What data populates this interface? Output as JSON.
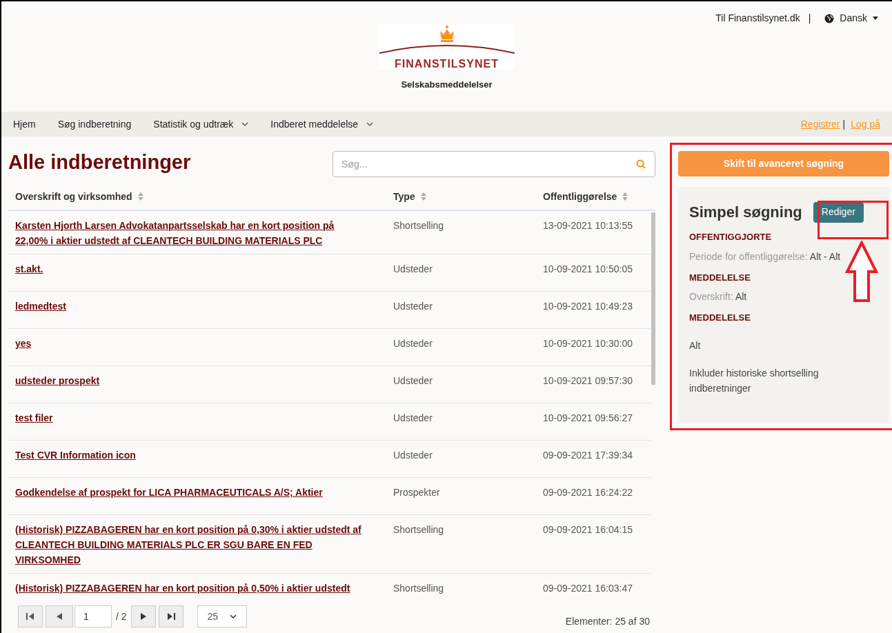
{
  "top_links": {
    "site_link": "Til Finanstilsynet.dk",
    "separator": "|",
    "language": "Dansk"
  },
  "logo": {
    "name": "FINANSTILSYNET",
    "subtitle": "Selskabsmeddelelser"
  },
  "nav": {
    "items": [
      {
        "label": "Hjem",
        "dropdown": false
      },
      {
        "label": "Søg indberetning",
        "dropdown": false
      },
      {
        "label": "Statistik og udtræk",
        "dropdown": true
      },
      {
        "label": "Indberet meddelelse",
        "dropdown": true
      }
    ],
    "auth": {
      "register": "Registrer",
      "separator": "|",
      "login": "Log på"
    }
  },
  "page_title": "Alle indberetninger",
  "search": {
    "placeholder": "Søg..."
  },
  "table": {
    "columns": [
      "Overskrift og virksomhed",
      "Type",
      "Offentliggørelse"
    ],
    "rows": [
      {
        "title": "Karsten Hjorth Larsen Advokatanpartsselskab har en kort position på 22,00% i aktier udstedt af CLEANTECH BUILDING MATERIALS PLC",
        "type": "Shortselling",
        "date": "13-09-2021 10:13:55"
      },
      {
        "title": "st.akt.",
        "type": "Udsteder",
        "date": "10-09-2021 10:50:05"
      },
      {
        "title": "ledmedtest",
        "type": "Udsteder",
        "date": "10-09-2021 10:49:23"
      },
      {
        "title": "yes",
        "type": "Udsteder",
        "date": "10-09-2021 10:30:00"
      },
      {
        "title": "udsteder prospekt",
        "type": "Udsteder",
        "date": "10-09-2021 09:57:30"
      },
      {
        "title": "test filer",
        "type": "Udsteder",
        "date": "10-09-2021 09:56:27"
      },
      {
        "title": "Test CVR Information icon",
        "type": "Udsteder",
        "date": "09-09-2021 17:39:34"
      },
      {
        "title": "Godkendelse af prospekt for LICA PHARMACEUTICALS A/S; Aktier",
        "type": "Prospekter",
        "date": "09-09-2021 16:24:22"
      },
      {
        "title": "(Historisk) PIZZABAGEREN har en kort position på 0,30% i aktier udstedt af CLEANTECH BUILDING MATERIALS PLC ER SGU BARE EN FED VIRKSOMHED",
        "type": "Shortselling",
        "date": "09-09-2021 16:04:15"
      },
      {
        "title": "(Historisk) PIZZABAGEREN har en kort position på 0,50% i aktier udstedt",
        "type": "Shortselling",
        "date": "09-09-2021 16:03:47"
      }
    ]
  },
  "pager": {
    "page": "1",
    "total": "/ 2",
    "page_size": "25",
    "count": "Elementer: 25 af 30"
  },
  "sidebar": {
    "advanced_button": "Skift til avanceret søgning",
    "heading": "Simpel søgning",
    "edit_button": "Rediger",
    "sections": [
      {
        "kind": "labeled",
        "title": "OFFENTIGGJORTE",
        "label": "Periode for offentliggørelse:",
        "value": "Alt - Alt"
      },
      {
        "kind": "labeled",
        "title": "MEDDELELSE",
        "label": "Overskrift:",
        "value": "Alt"
      },
      {
        "kind": "plain",
        "title": "MEDDELELSE",
        "value": "Alt"
      }
    ],
    "note": "Inkluder historiske shortselling indberetninger"
  }
}
